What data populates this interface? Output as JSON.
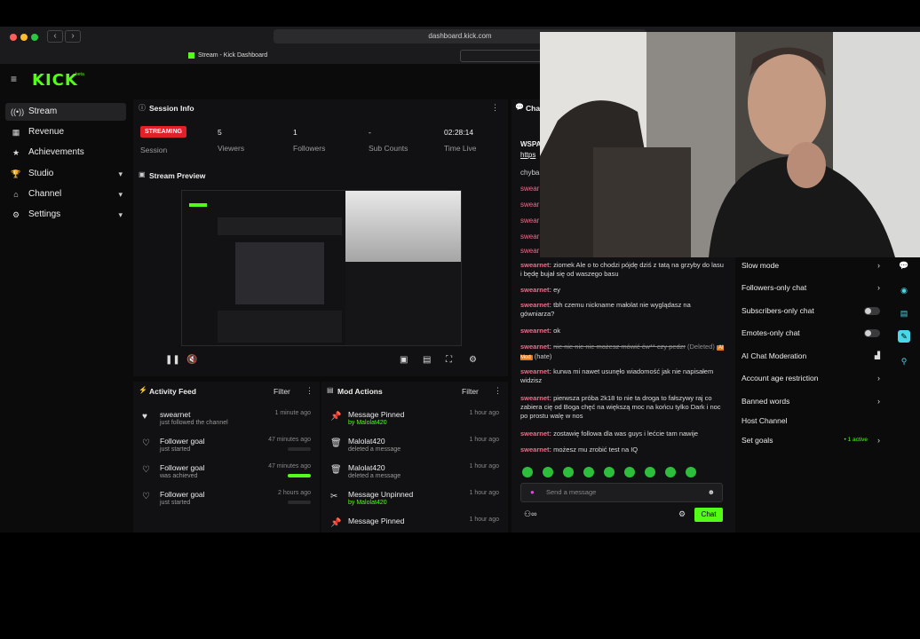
{
  "browser": {
    "url": "dashboard.kick.com",
    "tab_title": "Stream - Kick Dashboard",
    "back": "‹",
    "forward": "›"
  },
  "app": {
    "logo": "KICK",
    "logo_sup": "beta",
    "menu_icon": "≡"
  },
  "sidebar": {
    "items": [
      {
        "label": "Stream",
        "icon": "((•))",
        "active": true
      },
      {
        "label": "Revenue",
        "icon": "▦"
      },
      {
        "label": "Achievements",
        "icon": "★"
      },
      {
        "label": "Studio",
        "icon": "🏆",
        "expandable": true
      },
      {
        "label": "Channel",
        "icon": "⌂",
        "expandable": true
      },
      {
        "label": "Settings",
        "icon": "⚙",
        "expandable": true
      }
    ]
  },
  "session_info": {
    "title": "Session Info",
    "status_badge": "STREAMING",
    "status_label": "Session",
    "stats": [
      {
        "value": "5",
        "label": "Viewers"
      },
      {
        "value": "1",
        "label": "Followers"
      },
      {
        "value": "-",
        "label": "Sub Counts"
      },
      {
        "value": "02:28:14",
        "label": "Time Live"
      }
    ]
  },
  "stream_preview": {
    "title": "Stream Preview"
  },
  "activity_feed": {
    "title": "Activity Feed",
    "filter": "Filter",
    "items": [
      {
        "title": "swearnet",
        "sub": "just followed the channel",
        "time": "1 minute ago"
      },
      {
        "title": "Follower goal",
        "sub": "just started",
        "time": "47 minutes ago",
        "progress": 0
      },
      {
        "title": "Follower goal",
        "sub": "was achieved",
        "time": "47 minutes ago",
        "progress": 1
      },
      {
        "title": "Follower goal",
        "sub": "just started",
        "time": "2 hours ago",
        "progress": 0
      }
    ]
  },
  "mod_actions": {
    "title": "Mod Actions",
    "filter": "Filter",
    "items": [
      {
        "title": "Message Pinned",
        "sub": "by Malolat420",
        "time": "1 hour ago"
      },
      {
        "title": "Malolat420",
        "sub": "deleted a message",
        "time": "1 hour ago"
      },
      {
        "title": "Malolat420",
        "sub": "deleted a message",
        "time": "1 hour ago"
      },
      {
        "title": "Message Unpinned",
        "sub": "by Malolat420",
        "time": "1 hour ago"
      },
      {
        "title": "Message Pinned",
        "sub": "",
        "time": "1 hour ago"
      }
    ]
  },
  "chat": {
    "title": "Cha",
    "pinned_1": "WSPA",
    "pinned_2": "https",
    "partial": [
      "chyba",
      "swear",
      "swear",
      "swear",
      "swear",
      "swear"
    ],
    "messages": [
      {
        "user": "swearnet:",
        "text": "ziomek Ale o to chodzi pójdę dziś z tatą na grzyby do lasu i będę bujał się od waszego basu"
      },
      {
        "user": "swearnet:",
        "text": "ey"
      },
      {
        "user": "swearnet:",
        "text": "tbh czemu nickname małolat nie wyglądasz na gówniarza?"
      },
      {
        "user": "swearnet:",
        "text": "ok"
      },
      {
        "user": "swearnet:",
        "text": "nie nie nie nie możesz mówić ćw** czy pedzr",
        "deleted": true,
        "deleted_tag": "(Deleted)",
        "mod_tag": "AI Mod",
        "reason": "(hate)"
      },
      {
        "user": "swearnet:",
        "text": "kurwa mi nawet usunęło wiadomość jak nie napisałem widzisz"
      },
      {
        "user": "swearnet:",
        "text": "pierwsza próba 2k18 to nie ta droga to fałszywy raj co zabiera cię od Boga chęć na większą moc na końcu tylko Dark i noc po prostu walę w nos"
      },
      {
        "user": "swearnet:",
        "text": "zostawię followa dla was guys i lećcie tam nawije"
      },
      {
        "user": "swearnet:",
        "text": "możesz mu zrobić test na IQ"
      }
    ],
    "placeholder": "Send a message",
    "send": "Chat"
  },
  "chat_settings": {
    "rows": [
      {
        "label": "Slow mode",
        "control": "chevron"
      },
      {
        "label": "Followers-only chat",
        "control": "chevron"
      },
      {
        "label": "Subscribers-only chat",
        "control": "toggle"
      },
      {
        "label": "Emotes-only chat",
        "control": "toggle"
      },
      {
        "label": "AI Chat Moderation",
        "control": "icon"
      },
      {
        "label": "Account age restriction",
        "control": "chevron"
      },
      {
        "label": "Banned words",
        "control": "chevron"
      },
      {
        "label": "Host Channel",
        "control": "none"
      },
      {
        "label": "Set goals",
        "control": "chevron",
        "badge": "• 1 active"
      }
    ]
  },
  "colors": {
    "brand": "#53fc18",
    "streaming": "#e0202a",
    "username": "#f26b8a",
    "ai_mod": "#e07a1e"
  }
}
